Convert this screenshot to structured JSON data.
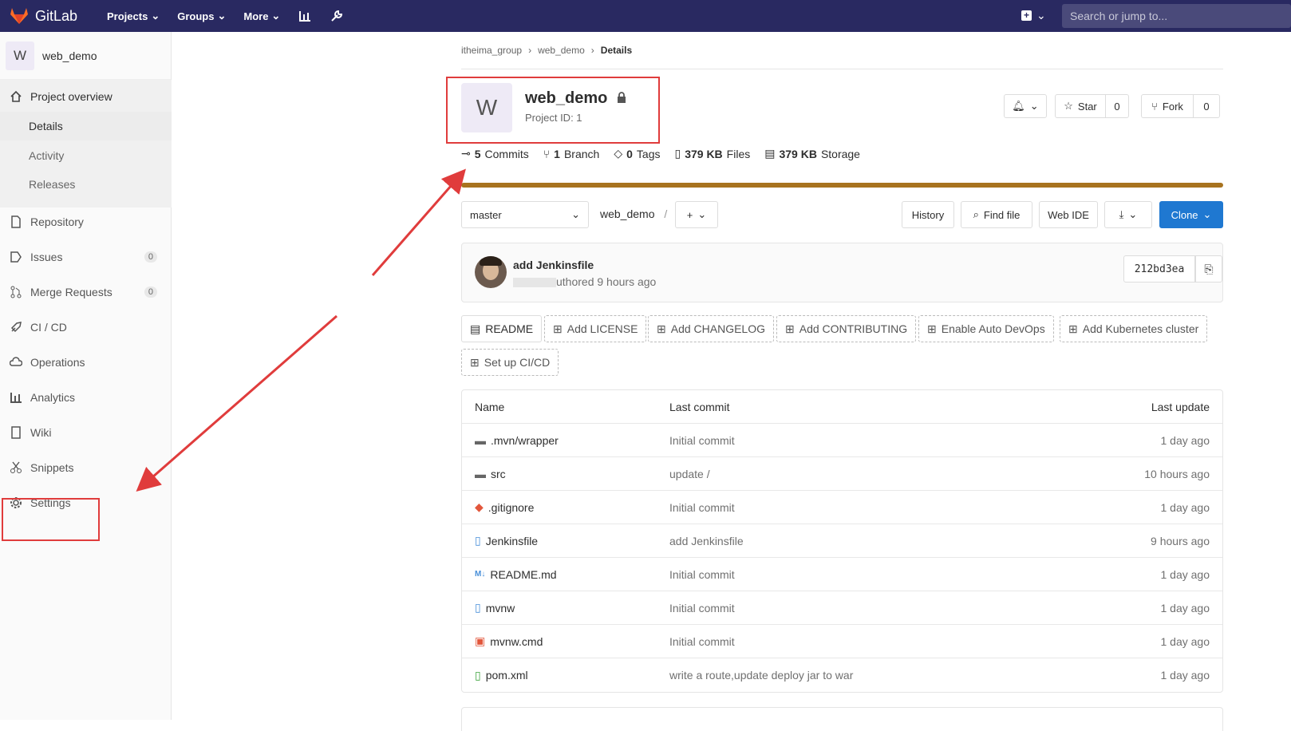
{
  "topbar": {
    "brand": "GitLab",
    "nav": [
      "Projects",
      "Groups",
      "More"
    ],
    "search_placeholder": "Search or jump to..."
  },
  "sidebar": {
    "avatar_letter": "W",
    "project_name": "web_demo",
    "overview": "Project overview",
    "sub_items": [
      "Details",
      "Activity",
      "Releases"
    ],
    "items": [
      {
        "label": "Repository",
        "icon": "document-icon"
      },
      {
        "label": "Issues",
        "icon": "issues-icon",
        "count": "0"
      },
      {
        "label": "Merge Requests",
        "icon": "merge-request-icon",
        "count": "0"
      },
      {
        "label": "CI / CD",
        "icon": "rocket-icon"
      },
      {
        "label": "Operations",
        "icon": "cloud-gear-icon"
      },
      {
        "label": "Analytics",
        "icon": "bar-chart-icon"
      },
      {
        "label": "Wiki",
        "icon": "book-icon"
      },
      {
        "label": "Snippets",
        "icon": "scissors-icon"
      },
      {
        "label": "Settings",
        "icon": "gear-icon"
      }
    ]
  },
  "breadcrumb": [
    "itheima_group",
    "web_demo",
    "Details"
  ],
  "project": {
    "avatar_letter": "W",
    "name": "web_demo",
    "id_text": "Project ID: 1",
    "star_label": "Star",
    "star_count": "0",
    "fork_label": "Fork",
    "fork_count": "0"
  },
  "stats": [
    {
      "num": "5",
      "label": "Commits"
    },
    {
      "num": "1",
      "label": "Branch"
    },
    {
      "num": "0",
      "label": "Tags"
    },
    {
      "num": "379 KB",
      "label": "Files"
    },
    {
      "num": "379 KB",
      "label": "Storage"
    }
  ],
  "toolbar": {
    "branch": "master",
    "path": "web_demo",
    "path_sep": "/",
    "history": "History",
    "find_file": "Find file",
    "web_ide": "Web IDE",
    "clone": "Clone"
  },
  "commit": {
    "title": "add Jenkinsfile",
    "meta": "uthored 9 hours ago",
    "sha": "212bd3ea"
  },
  "quick_buttons": [
    "README",
    "Add LICENSE",
    "Add CHANGELOG",
    "Add CONTRIBUTING",
    "Enable Auto DevOps",
    "Add Kubernetes cluster",
    "Set up CI/CD"
  ],
  "table": {
    "headers": [
      "Name",
      "Last commit",
      "Last update"
    ],
    "rows": [
      {
        "name": ".mvn/wrapper",
        "icon": "folder-icon",
        "commit": "Initial commit",
        "updated": "1 day ago"
      },
      {
        "name": "src",
        "icon": "folder-icon",
        "commit": "update /",
        "updated": "10 hours ago"
      },
      {
        "name": ".gitignore",
        "icon": "git-icon",
        "commit": "Initial commit",
        "updated": "1 day ago"
      },
      {
        "name": "Jenkinsfile",
        "icon": "file-icon",
        "commit": "add Jenkinsfile",
        "updated": "9 hours ago"
      },
      {
        "name": "README.md",
        "icon": "markdown-icon",
        "commit": "Initial commit",
        "updated": "1 day ago"
      },
      {
        "name": "mvnw",
        "icon": "file-icon",
        "commit": "Initial commit",
        "updated": "1 day ago"
      },
      {
        "name": "mvnw.cmd",
        "icon": "terminal-icon",
        "commit": "Initial commit",
        "updated": "1 day ago"
      },
      {
        "name": "pom.xml",
        "icon": "xml-file-icon",
        "commit": "write a route,update deploy jar to war",
        "updated": "1 day ago"
      }
    ]
  },
  "colors": {
    "topbar": "#292961",
    "clone": "#1f78d1",
    "progress": "#a8731f",
    "annotation": "#e03c3c"
  }
}
